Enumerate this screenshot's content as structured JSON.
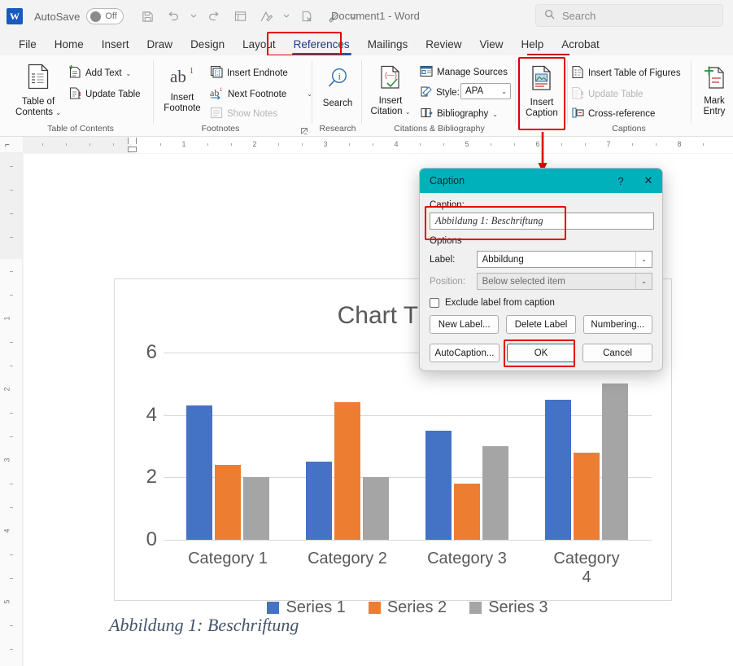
{
  "titlebar": {
    "logo": "W",
    "autosave_label": "AutoSave",
    "autosave_state": "Off",
    "document_title": "Document1  -  Word",
    "quick_access": [
      {
        "name": "save-icon",
        "glyph": "💾"
      },
      {
        "name": "undo-icon",
        "glyph": "↶"
      },
      {
        "name": "undo-dropdown-icon",
        "glyph": "⌄"
      },
      {
        "name": "redo-icon",
        "glyph": "↻"
      },
      {
        "name": "touch-mode-icon",
        "glyph": "☷"
      },
      {
        "name": "track-changes-icon",
        "glyph": "✐"
      },
      {
        "name": "track-changes-dropdown-icon",
        "glyph": "⌄"
      },
      {
        "name": "reject-change-icon",
        "glyph": "⌧"
      },
      {
        "name": "review-pen-icon",
        "glyph": "✒"
      },
      {
        "name": "customize-qat-icon",
        "glyph": "⌄"
      }
    ],
    "search": {
      "icon": "search-icon",
      "placeholder": "Search"
    }
  },
  "tabs": [
    {
      "label": "File",
      "active": false
    },
    {
      "label": "Home",
      "active": false
    },
    {
      "label": "Insert",
      "active": false
    },
    {
      "label": "Draw",
      "active": false
    },
    {
      "label": "Design",
      "active": false
    },
    {
      "label": "Layout",
      "active": false
    },
    {
      "label": "References",
      "active": true
    },
    {
      "label": "Mailings",
      "active": false
    },
    {
      "label": "Review",
      "active": false
    },
    {
      "label": "View",
      "active": false
    },
    {
      "label": "Help",
      "active": false
    },
    {
      "label": "Acrobat",
      "active": false
    }
  ],
  "ribbon": {
    "groups": [
      {
        "name": "table-of-contents",
        "label": "Table of Contents"
      },
      {
        "name": "footnotes",
        "label": "Footnotes"
      },
      {
        "name": "research",
        "label": "Research"
      },
      {
        "name": "citations-bibliography",
        "label": "Citations & Bibliography"
      },
      {
        "name": "captions",
        "label": "Captions"
      },
      {
        "name": "index",
        "label": ""
      }
    ],
    "table_of_contents": {
      "big_button": "Table of\nContents",
      "big_line1": "Table of",
      "big_line2": "Contents",
      "add_text": "Add Text",
      "update_table": "Update Table"
    },
    "footnotes": {
      "insert_footnote_line1": "Insert",
      "insert_footnote_line2": "Footnote",
      "insert_footnote_glyph": "ab",
      "insert_endnote": "Insert Endnote",
      "next_footnote": "Next Footnote",
      "show_notes": "Show Notes"
    },
    "research": {
      "search_label": "Search"
    },
    "citations": {
      "insert_citation_line1": "Insert",
      "insert_citation_line2": "Citation",
      "manage_sources": "Manage Sources",
      "style_label": "Style:",
      "style_value": "APA",
      "bibliography": "Bibliography"
    },
    "captions": {
      "insert_caption_line1": "Insert",
      "insert_caption_line2": "Caption",
      "insert_table_of_figures": "Insert Table of Figures",
      "update_table": "Update Table",
      "cross_reference": "Cross-reference"
    },
    "index": {
      "mark_entry_line1": "Mark",
      "mark_entry_line2": "Entry"
    }
  },
  "rulers": {
    "horizontal": [
      "1",
      "2",
      "3",
      "4",
      "5",
      "6",
      "7",
      "8"
    ],
    "vertical": [
      "1",
      "2",
      "3",
      "4",
      "5"
    ]
  },
  "dialog": {
    "title": "Caption",
    "help_glyph": "?",
    "close_glyph": "✕",
    "caption_label": "Caption:",
    "caption_value": "Abbildung 1: Beschriftung",
    "options_label": "Options",
    "label_label": "Label:",
    "label_value": "Abbildung",
    "position_label": "Position:",
    "position_value": "Below selected item",
    "exclude_label": "Exclude label from caption",
    "exclude_checked": false,
    "buttons_row1": [
      "New Label...",
      "Delete Label",
      "Numbering..."
    ],
    "buttons_row2": [
      "AutoCaption...",
      "OK",
      "Cancel"
    ]
  },
  "document": {
    "caption_text": "Abbildung 1: Beschriftung"
  },
  "chart_data": {
    "type": "bar",
    "title": "Chart Title",
    "categories": [
      "Category 1",
      "Category 2",
      "Category 3",
      "Category 4"
    ],
    "series": [
      {
        "name": "Series 1",
        "color": "#4472c4",
        "values": [
          4.3,
          2.5,
          3.5,
          4.5
        ]
      },
      {
        "name": "Series 2",
        "color": "#ed7d31",
        "values": [
          2.4,
          4.4,
          1.8,
          2.8
        ]
      },
      {
        "name": "Series 3",
        "color": "#a5a5a5",
        "values": [
          2.0,
          2.0,
          3.0,
          5.0
        ]
      }
    ],
    "yticks": [
      0,
      2,
      4,
      6
    ],
    "ylim": [
      0,
      6
    ],
    "xlabel": "",
    "ylabel": "",
    "grid": true,
    "legend_position": "bottom"
  },
  "colors": {
    "highlight_red": "#e00000",
    "dialog_teal": "#00b0ba",
    "tab_accent": "#2b579a",
    "word_blue": "#185abd"
  }
}
